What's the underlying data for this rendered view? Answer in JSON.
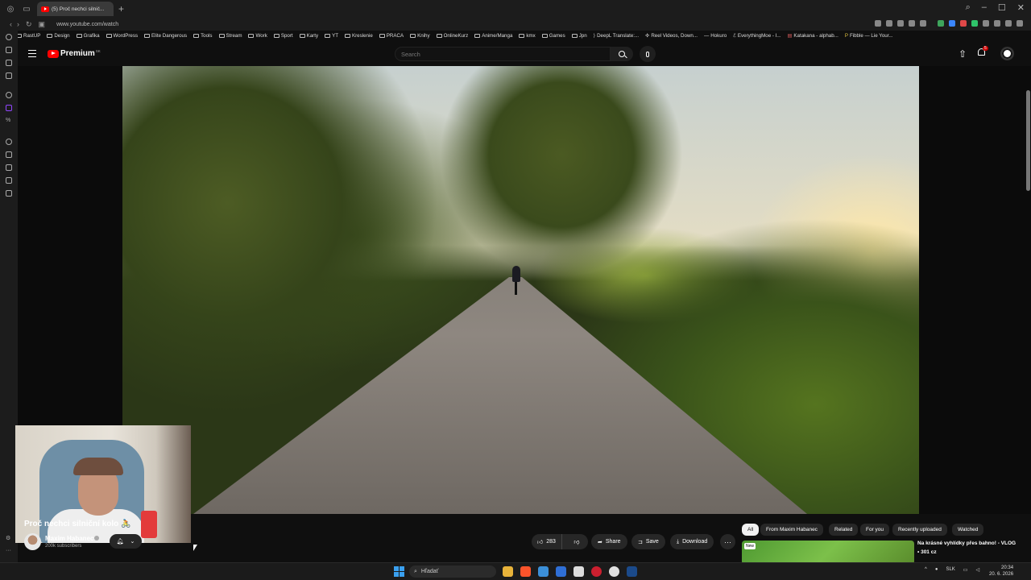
{
  "browser": {
    "tab_title": "(5) Proč nechci silnič...",
    "new_tab": "+",
    "url": "www.youtube.com/watch",
    "bookmarks": [
      "RastUP",
      "Design",
      "Grafika",
      "WordPress",
      "Elite Dangerous",
      "Tools",
      "Stream",
      "Work",
      "Sport",
      "Karty",
      "YT",
      "Kreslenie",
      "PRACA",
      "Knihy",
      "OnlineKurz",
      "Anime/Manga",
      "kmx",
      "Games",
      "Jpn",
      "DeepL Translate:...",
      "Reel Videos, Down...",
      "Hokuro",
      "EverythingMoe - I...",
      "Katakana - alphab...",
      "Fibble — Lie Your..."
    ]
  },
  "youtube": {
    "logo_text": "Premium",
    "logo_region": "SK",
    "search_placeholder": "Search",
    "notification_count": "5",
    "video_title": "Proč nechci silniční kolo 🚴",
    "channel_name": "Maxim Habanec",
    "subscribers": "200k subscribers",
    "actions": {
      "like_count": "283",
      "share_label": "Share",
      "save_label": "Save",
      "download_label": "Download",
      "more_label": "···"
    },
    "chips": [
      "All",
      "From Maxim Habanec",
      "Related",
      "For you",
      "Recently uploaded",
      "Watched"
    ],
    "recommendation": {
      "badge": "New",
      "title": "Na krásné vyhlídky přes bahno! - VLOG",
      "meta": "• 301 cz"
    }
  },
  "taskbar": {
    "search_placeholder": "Hľadať",
    "language": "SLK",
    "time": "20:34",
    "date": "20. 6. 2026"
  },
  "colors": {
    "youtube_red": "#ff0000",
    "chip_active_bg": "#f1f1f1",
    "page_bg": "#0f0f0f"
  }
}
